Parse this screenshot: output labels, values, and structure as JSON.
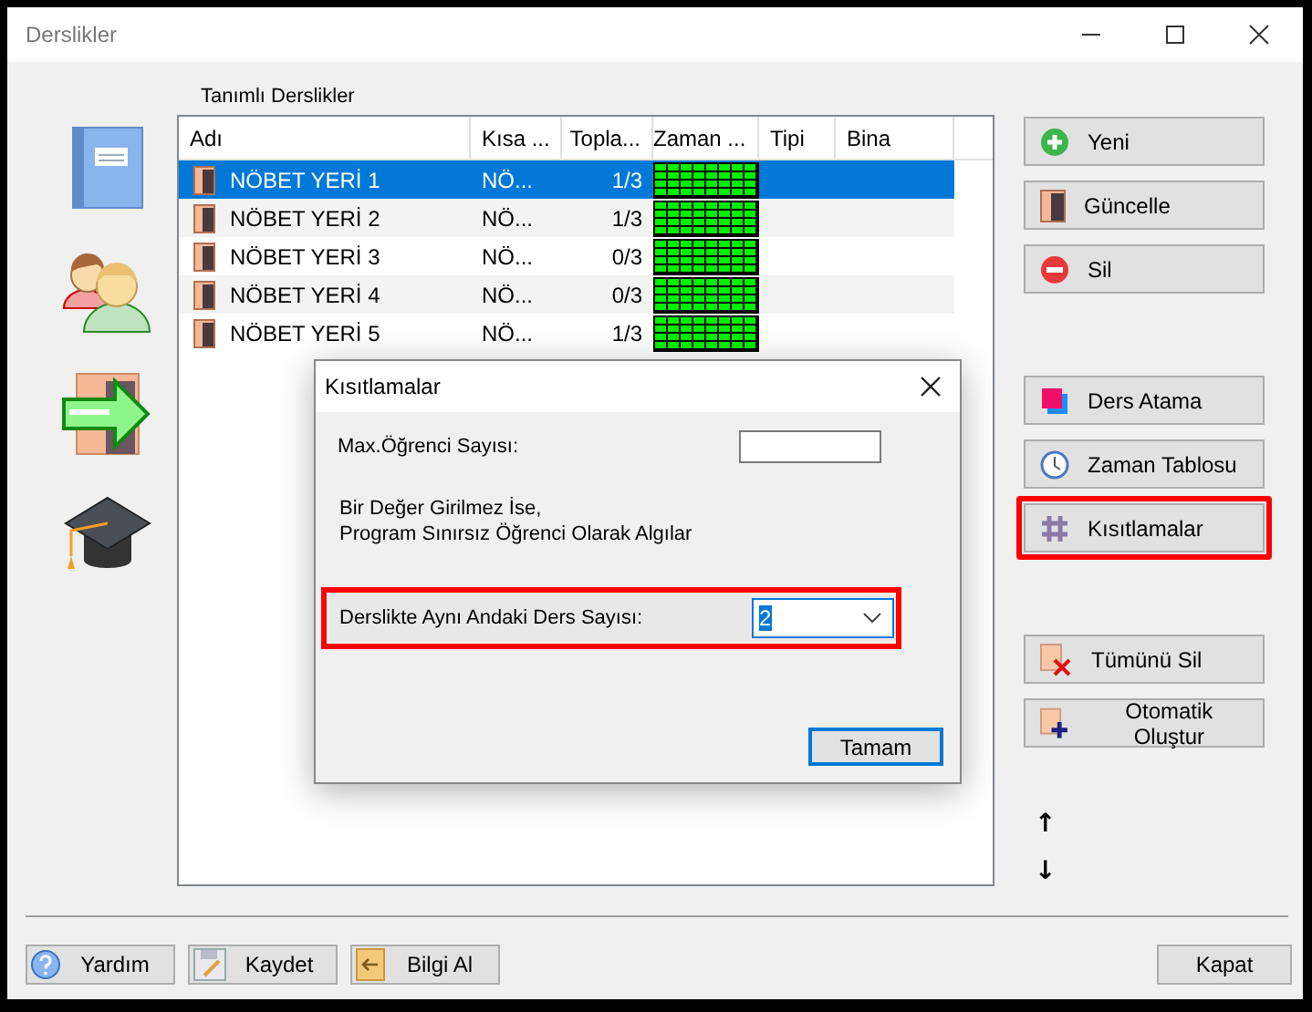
{
  "window": {
    "title": "Derslikler"
  },
  "list": {
    "label": "Tanımlı Derslikler",
    "columns": [
      "Adı",
      "Kısa ...",
      "Topla...",
      "Zaman ...",
      "Tipi",
      "Bina"
    ],
    "rows": [
      {
        "name": "NÖBET YERİ 1",
        "short": "NÖ...",
        "total": "1/3",
        "selected": true
      },
      {
        "name": "NÖBET YERİ 2",
        "short": "NÖ...",
        "total": "1/3",
        "selected": false
      },
      {
        "name": "NÖBET YERİ 3",
        "short": "NÖ...",
        "total": "0/3",
        "selected": false
      },
      {
        "name": "NÖBET YERİ 4",
        "short": "NÖ...",
        "total": "0/3",
        "selected": false
      },
      {
        "name": "NÖBET YERİ 5",
        "short": "NÖ...",
        "total": "1/3",
        "selected": false
      }
    ]
  },
  "actions": [
    {
      "label": "Yeni",
      "kind": "plus",
      "highlighted": false
    },
    {
      "label": "Güncelle",
      "kind": "door",
      "highlighted": false
    },
    {
      "label": "Sil",
      "kind": "minus",
      "highlighted": false
    },
    {
      "label": "Ders Atama",
      "kind": "squares",
      "highlighted": false
    },
    {
      "label": "Zaman Tablosu",
      "kind": "clock",
      "highlighted": false
    },
    {
      "label": "Kısıtlamalar",
      "kind": "hash",
      "highlighted": true
    },
    {
      "label": "Tümünü Sil",
      "kind": "clear",
      "highlighted": false
    },
    {
      "label": "Otomatik Oluştur",
      "kind": "auto",
      "highlighted": false
    }
  ],
  "move_buttons": [
    "↑",
    "↓"
  ],
  "footer": {
    "buttons": [
      {
        "label": "Yardım",
        "kind": "help"
      },
      {
        "label": "Kaydet",
        "kind": "save"
      },
      {
        "label": "Bilgi Al",
        "kind": "import"
      }
    ],
    "close": "Kapat"
  },
  "dialog": {
    "title": "Kısıtlamalar",
    "max_label": "Max.Öğrenci Sayısı:",
    "note": [
      "Bir Değer Girilmez İse,",
      "Program Sınırsız Öğrenci Olarak Algılar"
    ],
    "lessons_label": "Derslikte Aynı Andaki Ders Sayısı:",
    "lessons_value": "2",
    "lessons_highlighted": true,
    "ok": "Tamam"
  }
}
